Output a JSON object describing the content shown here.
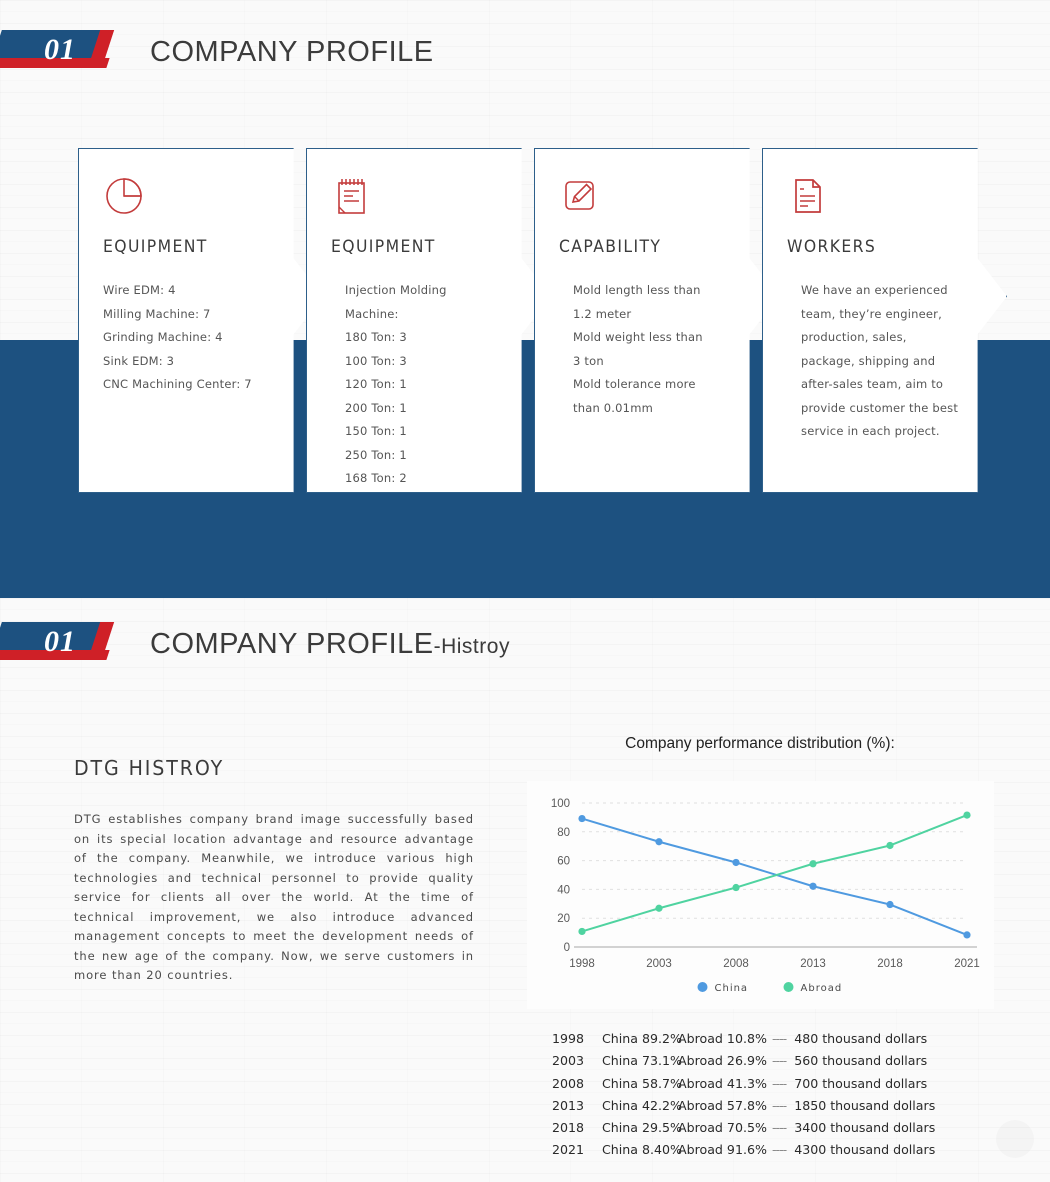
{
  "section1": {
    "number": "01",
    "title": "COMPANY PROFILE",
    "suffix": ""
  },
  "section2": {
    "number": "01",
    "title": "COMPANY PROFILE",
    "suffix": "-Histroy"
  },
  "cards": [
    {
      "icon": "pie-chart-icon",
      "title": "EQUIPMENT",
      "lines": [
        "Wire EDM: 4",
        "Milling Machine: 7",
        "Grinding Machine: 4",
        "Sink EDM: 3",
        "CNC Machining Center: 7"
      ]
    },
    {
      "icon": "notepad-icon",
      "title": "EQUIPMENT",
      "lines": [
        "Injection Molding",
        "Machine:",
        "180 Ton: 3",
        "100 Ton: 3",
        "120 Ton: 1",
        "200 Ton: 1",
        "150 Ton: 1",
        "250 Ton: 1",
        "168 Ton: 2"
      ]
    },
    {
      "icon": "pencil-edit-icon",
      "title": "CAPABILITY",
      "lines": [
        "Mold length less than",
        "1.2 meter",
        "Mold weight less than",
        "3 ton",
        "Mold tolerance more",
        "than 0.01mm"
      ]
    },
    {
      "icon": "document-icon",
      "title": "WORKERS",
      "lines": [
        "We have an experienced",
        "team, they’re engineer,",
        "production, sales,",
        "package, shipping and",
        "after-sales team, aim to",
        "provide customer the best",
        "service in each project."
      ]
    }
  ],
  "histroy": {
    "heading": "DTG HISTROY",
    "paragraph": "DTG establishes company brand image successfully based on its special location advantage and resource advantage of the company. Meanwhile, we introduce various high technologies and technical personnel to provide quality service for clients all over the world. At the time of technical improvement, we also introduce advanced management concepts to meet the development needs of the new age of the company. Now, we serve customers in more than 20 countries."
  },
  "chart_data": {
    "type": "line",
    "title": "Company performance distribution (%):",
    "xlabel": "",
    "ylabel": "",
    "categories": [
      "1998",
      "2003",
      "2008",
      "2013",
      "2018",
      "2021"
    ],
    "series": [
      {
        "name": "China",
        "values": [
          89.2,
          73.1,
          58.7,
          42.2,
          29.5,
          8.4
        ],
        "color": "#4f9ae0"
      },
      {
        "name": "Abroad",
        "values": [
          10.8,
          26.9,
          41.3,
          57.8,
          70.5,
          91.6
        ],
        "color": "#4fd3a0"
      }
    ],
    "ylim": [
      0,
      100
    ],
    "yticks": [
      0,
      20,
      40,
      60,
      80,
      100
    ],
    "grid": true,
    "legend_position": "bottom"
  },
  "data_list": {
    "rows": [
      {
        "year": "1998",
        "china": "China 89.2%",
        "abroad": "Abroad 10.8%",
        "dash": "----",
        "amount": "480 thousand dollars"
      },
      {
        "year": "2003",
        "china": "China 73.1%",
        "abroad": "Abroad 26.9%",
        "dash": "----",
        "amount": "560 thousand dollars"
      },
      {
        "year": "2008",
        "china": "China 58.7%",
        "abroad": "Abroad 41.3%",
        "dash": "----",
        "amount": "700 thousand dollars"
      },
      {
        "year": "2013",
        "china": "China 42.2%",
        "abroad": "Abroad 57.8%",
        "dash": "----",
        "amount": "1850 thousand dollars"
      },
      {
        "year": "2018",
        "china": "China 29.5%",
        "abroad": "Abroad 70.5%",
        "dash": "----",
        "amount": "3400 thousand dollars"
      },
      {
        "year": "2021",
        "china": "China 8.40%",
        "abroad": "Abroad 91.6%",
        "dash": "----",
        "amount": "4300 thousand dollars"
      }
    ]
  },
  "colors": {
    "brand_blue": "#1d5180",
    "brand_red": "#cf2027",
    "icon_red": "#c33c3c",
    "china": "#4f9ae0",
    "abroad": "#4fd3a0"
  }
}
